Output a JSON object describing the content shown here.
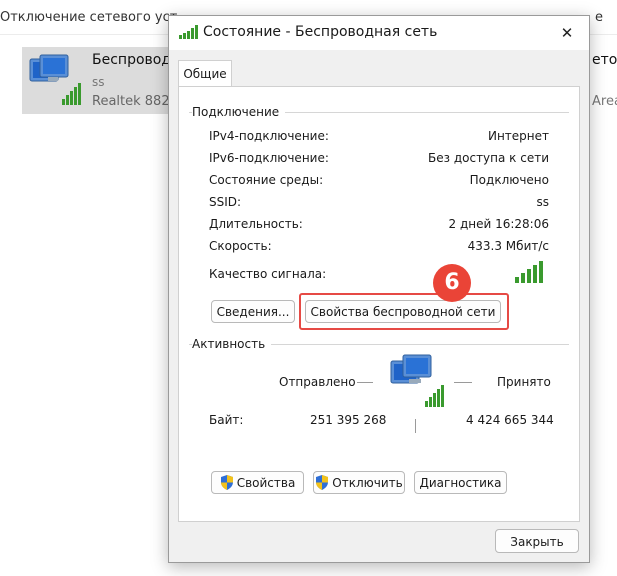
{
  "background": {
    "toolbar_text": "Отключение сетевого уст",
    "toolbar_right": "е",
    "adapter_name": "Беспровод",
    "adapter_ssid": "ss",
    "adapter_device": "Realtek 882",
    "right_name": "етос",
    "right_device": "Area"
  },
  "dialog": {
    "title": "Состояние - Беспроводная сеть",
    "close_glyph": "✕",
    "tab": "Общие",
    "connection_group": "Подключение",
    "rows": [
      {
        "label": "IPv4-подключение:",
        "value": "Интернет"
      },
      {
        "label": "IPv6-подключение:",
        "value": "Без доступа к сети"
      },
      {
        "label": "Состояние среды:",
        "value": "Подключено"
      },
      {
        "label": "SSID:",
        "value": "ss"
      },
      {
        "label": "Длительность:",
        "value": "2 дней 16:28:06"
      },
      {
        "label": "Скорость:",
        "value": "433.3 Мбит/с"
      }
    ],
    "signal_label": "Качество сигнала:",
    "signal_bars": 5,
    "details_button": "Сведения...",
    "wireless_props_button": "Свойства беспроводной сети",
    "step_badge": "6",
    "activity_group": "Активность",
    "sent_label": "Отправлено",
    "received_label": "Принято",
    "bytes_label": "Байт:",
    "bytes_sent": "251 395 268",
    "bytes_received": "4 424 665 344",
    "properties_button": "Свойства",
    "disable_button": "Отключить",
    "diagnostics_button": "Диагностика",
    "close_button": "Закрыть"
  },
  "colors": {
    "signal_green": "#3a9a2e",
    "highlight_red": "#e64a45",
    "badge_red": "#ea4437",
    "shield_blue": "#2f6fd6",
    "shield_yellow": "#f2c21b"
  }
}
